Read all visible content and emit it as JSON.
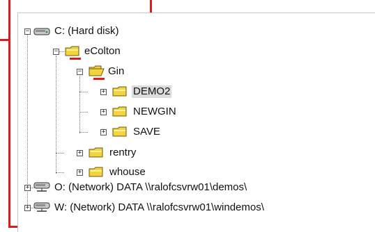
{
  "tree": {
    "nodes": [
      {
        "id": "c-drive",
        "label": "C: (Hard disk)",
        "type": "drive",
        "expanded": true,
        "toggle": "−"
      },
      {
        "id": "ecolton",
        "label": "eColton",
        "type": "folder",
        "expanded": true,
        "toggle": "−"
      },
      {
        "id": "gin",
        "label": "Gin",
        "type": "folder-open",
        "expanded": true,
        "toggle": "−"
      },
      {
        "id": "demo2",
        "label": "DEMO2",
        "type": "folder",
        "expanded": false,
        "toggle": "+",
        "selected": true
      },
      {
        "id": "newgin",
        "label": "NEWGIN",
        "type": "folder",
        "expanded": false,
        "toggle": "+"
      },
      {
        "id": "save",
        "label": "SAVE",
        "type": "folder",
        "expanded": false,
        "toggle": "+"
      },
      {
        "id": "rentry",
        "label": "rentry",
        "type": "folder",
        "expanded": false,
        "toggle": "+"
      },
      {
        "id": "whouse",
        "label": "whouse",
        "type": "folder",
        "expanded": false,
        "toggle": "+"
      },
      {
        "id": "o-drive",
        "label": "O: (Network)  DATA  \\\\ralofcsvrw01\\demos\\",
        "type": "network-drive",
        "expanded": false,
        "toggle": "+"
      },
      {
        "id": "w-drive",
        "label": "W: (Network)  DATA  \\\\ralofcsvrw01\\windemos\\",
        "type": "network-drive",
        "expanded": false,
        "toggle": "+"
      }
    ]
  },
  "colors": {
    "highlight_red": "#d61e1e",
    "folder_yellow": "#f5d33a",
    "selection_bg": "#dcdcdc"
  }
}
